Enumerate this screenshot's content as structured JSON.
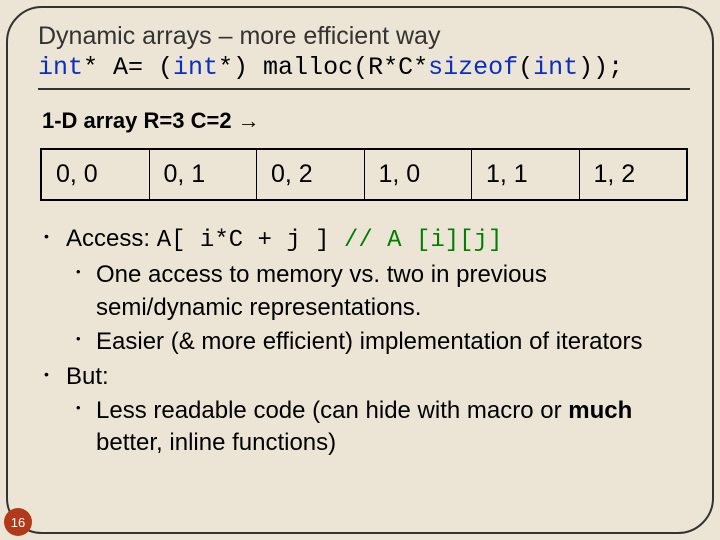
{
  "title": "Dynamic arrays – more efficient way",
  "code": {
    "p1": "int",
    "p2": "* A= (",
    "p3": "int",
    "p4": "*) malloc(R*C*",
    "p5": "sizeof",
    "p6": "(",
    "p7": "int",
    "p8": "));"
  },
  "subtitle": "1-D array R=3 C=2 →",
  "cells": [
    "0, 0",
    "0, 1",
    "0, 2",
    "1, 0",
    "1, 1",
    "1, 2"
  ],
  "bullets": {
    "access_label": "Access: ",
    "access_code": "A[ i*C + j ]",
    "access_comment": " // A [i][j]",
    "sub1": "One access to memory vs. two in previous semi/dynamic representations.",
    "sub2": "Easier (& more efficient) implementation of iterators",
    "but_label": "But:",
    "but_sub_pre": "Less readable code (can hide with macro or ",
    "but_sub_bold": "much",
    "but_sub_post": " better, inline functions)"
  },
  "pagenum": "16"
}
